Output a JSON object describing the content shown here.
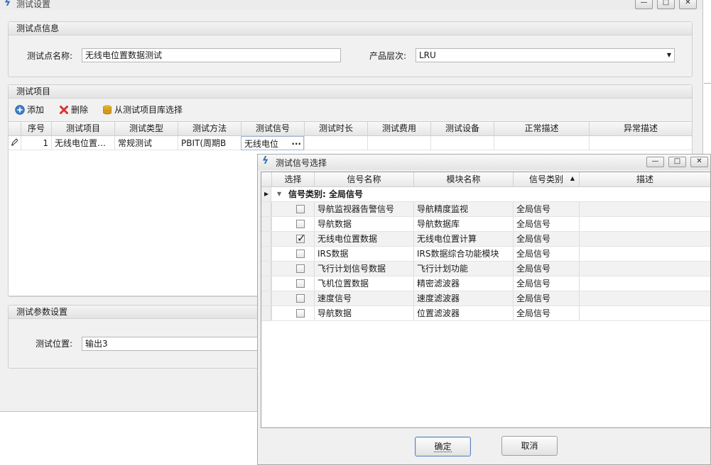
{
  "main_window": {
    "title": "测试设置",
    "controls": [
      "—",
      "□",
      "✕"
    ]
  },
  "point_info": {
    "heading": "测试点信息",
    "name_label": "测试点名称:",
    "name_value": "无线电位置数据测试",
    "level_label": "产品层次:",
    "level_value": "LRU"
  },
  "test_items": {
    "heading": "测试项目",
    "toolbar": {
      "add": "添加",
      "delete": "删除",
      "from_lib": "从测试项目库选择"
    },
    "columns": [
      "序号",
      "测试项目",
      "测试类型",
      "测试方法",
      "测试信号",
      "测试时长",
      "测试费用",
      "测试设备",
      "正常描述",
      "异常描述"
    ],
    "rows": [
      {
        "no": "1",
        "item": "无线电位置…",
        "type": "常规测试",
        "method": "PBIT(周期B",
        "signal": "无线电位",
        "ellipsis": "···"
      }
    ]
  },
  "params": {
    "heading": "测试参数设置",
    "position_label": "测试位置:",
    "position_value": "输出3"
  },
  "signal_dialog": {
    "title": "测试信号选择",
    "controls": [
      "—",
      "□",
      "✕"
    ],
    "columns": [
      "选择",
      "信号名称",
      "模块名称",
      "信号类别",
      "描述"
    ],
    "sort_indicator": "▲",
    "group_label": "信号类别: 全局信号",
    "rows": [
      {
        "checked": false,
        "name": "导航监视器告警信号",
        "module": "导航精度监视",
        "category": "全局信号"
      },
      {
        "checked": false,
        "name": "导航数据",
        "module": "导航数据库",
        "category": "全局信号"
      },
      {
        "checked": true,
        "name": "无线电位置数据",
        "module": "无线电位置计算",
        "category": "全局信号"
      },
      {
        "checked": false,
        "name": "IRS数据",
        "module": "IRS数据综合功能模块",
        "category": "全局信号"
      },
      {
        "checked": false,
        "name": "飞行计划信号数据",
        "module": "飞行计划功能",
        "category": "全局信号"
      },
      {
        "checked": false,
        "name": "飞机位置数据",
        "module": "精密滤波器",
        "category": "全局信号"
      },
      {
        "checked": false,
        "name": "速度信号",
        "module": "速度滤波器",
        "category": "全局信号"
      },
      {
        "checked": false,
        "name": "导航数据",
        "module": "位置滤波器",
        "category": "全局信号"
      }
    ],
    "ok_label": "确定",
    "cancel_label": "取消"
  },
  "colors": {
    "accent": "#2c6fb8",
    "delete": "#d9342b",
    "db": "#e0a41b"
  }
}
